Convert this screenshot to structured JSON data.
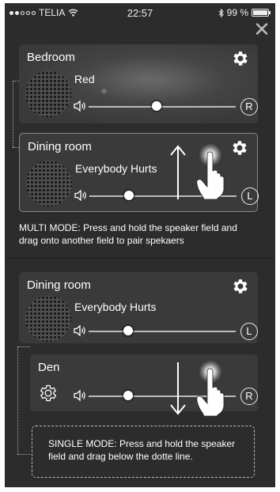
{
  "status": {
    "carrier": "TELIA",
    "time": "22:57",
    "battery": "99 %",
    "battery_level": 0.99
  },
  "close_symbol": "✕",
  "top": {
    "bedroom": {
      "room": "Bedroom",
      "track": "Red",
      "badge": "R",
      "volume": 0.46
    },
    "dining": {
      "room": "Dining room",
      "track": "Everybody Hurts",
      "badge": "L",
      "volume": 0.27
    },
    "message": "MULTI MODE: Press and hold the speaker field and drag onto another field to pair spekaers"
  },
  "bottom": {
    "dining": {
      "room": "Dining room",
      "track": "Everybody Hurts",
      "badge": "L",
      "volume": 0.27
    },
    "den": {
      "room": "Den",
      "badge": "R",
      "volume": 0.27
    },
    "message": "SINGLE MODE: Press and hold the speaker field and drag below the dotte line."
  },
  "icons": [
    "wifi-icon",
    "bluetooth-icon",
    "battery-icon",
    "close-icon",
    "gear-icon",
    "volume-icon",
    "arrow-up-icon",
    "arrow-down-icon",
    "hand-pointer-icon"
  ]
}
